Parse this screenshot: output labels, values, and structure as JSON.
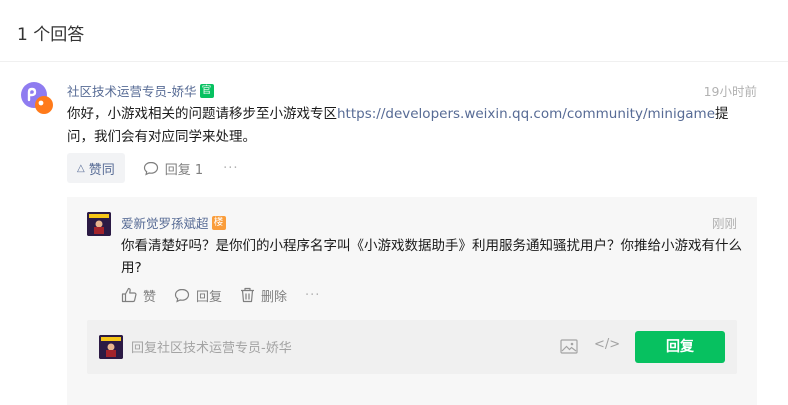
{
  "answers": {
    "count_title": "1 个回答"
  },
  "answer": {
    "author": "社区技术运营专员-娇华",
    "author_badge": "官",
    "time": "19小时前",
    "content_before_link": "你好，小游戏相关的问题请移步至小游戏专区",
    "link": "https://developers.weixin.qq.com/community/minigame",
    "content_after_link": "提问，我们会有对应同学来处理。",
    "like_label": "赞同",
    "reply_label": "回复 1",
    "more_label": "···"
  },
  "reply": {
    "author": "爱新觉罗孫斌超",
    "author_badge": "楼",
    "time": "刚刚",
    "content": "你看清楚好吗？是你们的小程序名字叫《小游戏数据助手》利用服务通知骚扰用户？你推给小游戏有什么用?",
    "like_label": "赞",
    "reply_label": "回复",
    "delete_label": "删除",
    "more_label": "···"
  },
  "reply_input": {
    "placeholder": "回复社区技术运营专员-娇华",
    "code_label": "</>",
    "send_label": "回复"
  },
  "colors": {
    "accent_green": "#07c160",
    "link_blue": "#576b95",
    "muted": "#b2b2b2",
    "badge_orange": "#fa9d3b"
  }
}
